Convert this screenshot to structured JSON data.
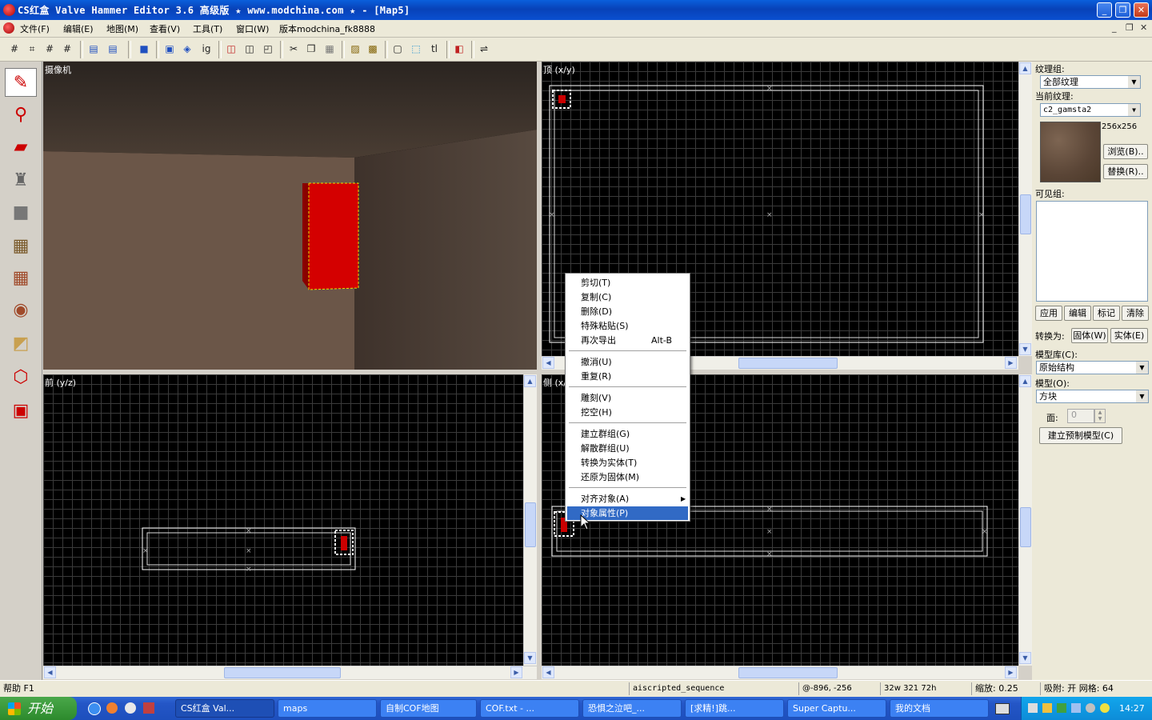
{
  "window": {
    "title": "CS红盒 Valve Hammer Editor 3.6 高级版 ★ www.modchina.com ★ - [Map5]",
    "controls": [
      "_",
      "❐",
      "✕"
    ]
  },
  "menubar": {
    "items": [
      "文件(F)",
      "编辑(E)",
      "地图(M)",
      "查看(V)",
      "工具(T)",
      "窗口(W)"
    ],
    "version": "版本modchina_fk8888",
    "mdi_controls": [
      "_",
      "❐",
      "✕"
    ]
  },
  "viewports": {
    "camera": {
      "label": "摄像机"
    },
    "top": {
      "label": "顶 (x/y)"
    },
    "front": {
      "label": "前 (y/z)"
    },
    "side": {
      "label": "侧 (x/z)"
    }
  },
  "right_panel": {
    "texture_group_label": "纹理组:",
    "texture_group_value": "全部纹理",
    "current_texture_label": "当前纹理:",
    "current_texture_value": "c2_gamsta2",
    "texture_size": "256x256",
    "browse_button": "浏览(B)..",
    "replace_button": "替换(R)..",
    "visgroup_label": "可见组:",
    "apply_button": "应用",
    "edit_button": "编辑",
    "mark_button": "标记",
    "clear_button": "清除",
    "convert_label": "转换为:",
    "to_world_button": "固体(W)",
    "to_entity_button": "实体(E)",
    "prefab_lib_label": "模型库(C):",
    "prefab_lib_value": "原始结构",
    "prefab_label": "模型(O):",
    "prefab_value": "方块",
    "faces_label": "面:",
    "faces_value": "0",
    "create_prefab_button": "建立预制模型(C)"
  },
  "context_menu": {
    "items": [
      {
        "label": "剪切(T)"
      },
      {
        "label": "复制(C)"
      },
      {
        "label": "删除(D)"
      },
      {
        "label": "特殊粘贴(S)"
      },
      {
        "label": "再次导出",
        "accel": "Alt-B"
      },
      {
        "label": "撤消(U)"
      },
      {
        "label": "重复(R)"
      },
      {
        "label": "雕刻(V)"
      },
      {
        "label": "挖空(H)"
      },
      {
        "label": "建立群组(G)"
      },
      {
        "label": "解散群组(U)"
      },
      {
        "label": "转换为实体(T)"
      },
      {
        "label": "还原为固体(M)"
      },
      {
        "label": "对齐对象(A)"
      },
      {
        "label": "对象属性(P)"
      }
    ]
  },
  "statusbar": {
    "help": "帮助 F1",
    "object": "aiscripted_sequence",
    "coords": "@-896, -256",
    "size": "32w 321 72h",
    "zoom": "缩放: 0.25",
    "snap_grid": "吸附: 开 网格: 64"
  },
  "taskbar": {
    "start": "开始",
    "tasks": [
      "CS红盒 Val...",
      "maps",
      "自制COF地图",
      "COF.txt - ...",
      "恐惧之泣吧_...",
      "[求精!]跳...",
      "Super Captu...",
      "我的文档"
    ],
    "clock": "14:27"
  },
  "colors": {
    "titlebar": "#0842b8",
    "selection": "#316ac5",
    "red_block": "#d40000",
    "grid_line": "#3a3a3a"
  }
}
